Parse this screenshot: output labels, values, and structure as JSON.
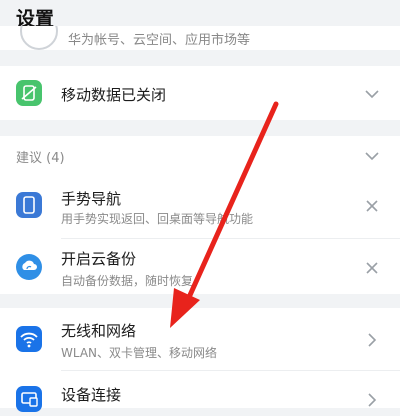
{
  "header": {
    "title": "设置"
  },
  "account_row": {
    "text_cut": "华为帐号、云空间、应用市场等"
  },
  "mobile_data": {
    "title": "移动数据已关闭"
  },
  "suggestions": {
    "label": "建议 (4)",
    "items": [
      {
        "title": "手势导航",
        "subtitle": "用手势实现返回、回桌面等导航功能"
      },
      {
        "title": "开启云备份",
        "subtitle": "自动备份数据，随时恢复"
      }
    ]
  },
  "settings": {
    "items": [
      {
        "title": "无线和网络",
        "subtitle": "WLAN、双卡管理、移动网络"
      },
      {
        "title": "设备连接",
        "subtitle": ""
      }
    ]
  },
  "colors": {
    "accent_blue": "#1a73e8",
    "mobile_green": "#48c46d",
    "arrow_red": "#e8231c"
  }
}
